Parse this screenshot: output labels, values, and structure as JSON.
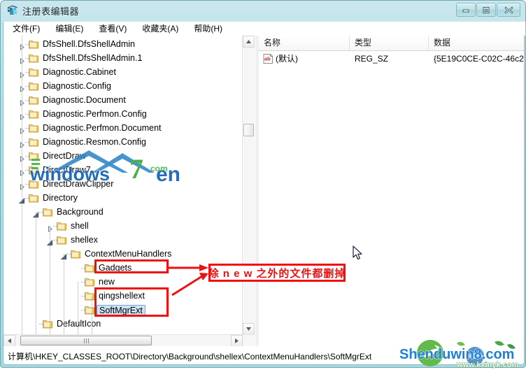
{
  "window": {
    "title": "注册表编辑器",
    "icon": "registry-editor-icon",
    "controls": {
      "minimize": "最小化",
      "maximize": "最大化",
      "close": "关闭"
    }
  },
  "menubar": {
    "items": [
      {
        "label": "文件(F)",
        "name": "menu-file"
      },
      {
        "label": "编辑(E)",
        "name": "menu-edit"
      },
      {
        "label": "查看(V)",
        "name": "menu-view"
      },
      {
        "label": "收藏夹(A)",
        "name": "menu-favorites"
      },
      {
        "label": "帮助(H)",
        "name": "menu-help"
      }
    ]
  },
  "tree": {
    "rows": [
      {
        "label": "DfsShell.DfsShellAdmin",
        "indent": 1,
        "glyph": "collapsed",
        "selected": false
      },
      {
        "label": "DfsShell.DfsShellAdmin.1",
        "indent": 1,
        "glyph": "collapsed",
        "selected": false
      },
      {
        "label": "Diagnostic.Cabinet",
        "indent": 1,
        "glyph": "collapsed",
        "selected": false
      },
      {
        "label": "Diagnostic.Config",
        "indent": 1,
        "glyph": "collapsed",
        "selected": false
      },
      {
        "label": "Diagnostic.Document",
        "indent": 1,
        "glyph": "collapsed",
        "selected": false
      },
      {
        "label": "Diagnostic.Perfmon.Config",
        "indent": 1,
        "glyph": "collapsed",
        "selected": false
      },
      {
        "label": "Diagnostic.Perfmon.Document",
        "indent": 1,
        "glyph": "collapsed",
        "selected": false
      },
      {
        "label": "Diagnostic.Resmon.Config",
        "indent": 1,
        "glyph": "collapsed",
        "selected": false
      },
      {
        "label": "DirectDraw",
        "indent": 1,
        "glyph": "collapsed",
        "selected": false
      },
      {
        "label": "DirectDraw7",
        "indent": 1,
        "glyph": "collapsed",
        "selected": false
      },
      {
        "label": "DirectDrawClipper",
        "indent": 1,
        "glyph": "collapsed",
        "selected": false
      },
      {
        "label": "Directory",
        "indent": 1,
        "glyph": "expanded",
        "selected": false
      },
      {
        "label": "Background",
        "indent": 2,
        "glyph": "expanded",
        "selected": false
      },
      {
        "label": "shell",
        "indent": 3,
        "glyph": "collapsed",
        "selected": false
      },
      {
        "label": "shellex",
        "indent": 3,
        "glyph": "expanded",
        "selected": false
      },
      {
        "label": "ContextMenuHandlers",
        "indent": 4,
        "glyph": "expanded",
        "selected": false
      },
      {
        "label": "Gadgets",
        "indent": 5,
        "glyph": "none",
        "selected": false
      },
      {
        "label": "new",
        "indent": 5,
        "glyph": "none",
        "selected": false
      },
      {
        "label": "qingshellext",
        "indent": 5,
        "glyph": "none",
        "selected": false
      },
      {
        "label": "SoftMgrExt",
        "indent": 5,
        "glyph": "none",
        "selected": true
      },
      {
        "label": "DefaultIcon",
        "indent": 2,
        "glyph": "none",
        "selected": false
      }
    ]
  },
  "list": {
    "columns": [
      {
        "label": "名称",
        "name": "column-name"
      },
      {
        "label": "类型",
        "name": "column-type"
      },
      {
        "label": "数据",
        "name": "column-data"
      }
    ],
    "rows": [
      {
        "icon": "string-value-icon",
        "name": "(默认)",
        "type": "REG_SZ",
        "data": "{5E19C0CE-C02C-46c2"
      }
    ]
  },
  "statusbar": {
    "path": "计算机\\HKEY_CLASSES_ROOT\\Directory\\Background\\shellex\\ContextMenuHandlers\\SoftMgrExt"
  },
  "annotation": {
    "text": "除 n e w 之外的文件都删掉",
    "color": "#ee1111"
  },
  "watermarks": {
    "tree": "windows7en.com",
    "corner": "Shenduwin8.com",
    "corner_sub": "www.kxinyk.com"
  },
  "colors": {
    "accent": "#a8d8df",
    "frame": "#6fa8b3",
    "annotation": "#ee1111",
    "selection": "#cce3f8"
  }
}
